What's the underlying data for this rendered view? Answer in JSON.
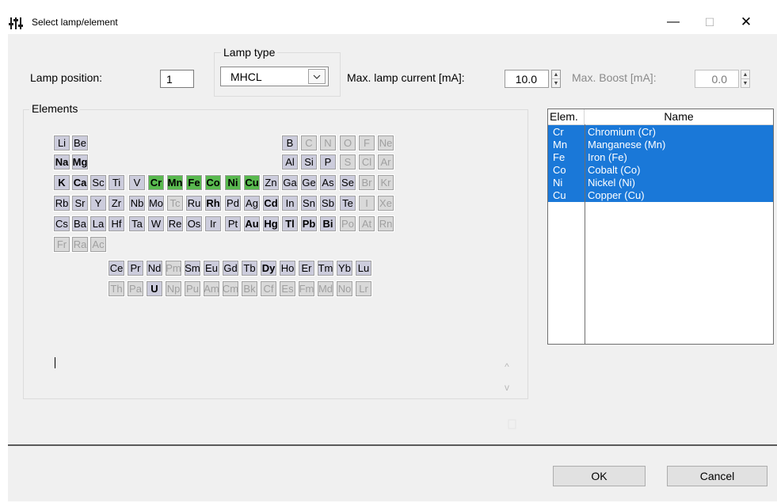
{
  "window": {
    "title": "Select lamp/element",
    "minimize": "—",
    "maximize": "☐",
    "close": "✕"
  },
  "form": {
    "lamp_position_label": "Lamp position:",
    "lamp_position_value": "1",
    "lamp_type_label": "Lamp type",
    "lamp_type_value": "MHCL",
    "max_current_label": "Max. lamp current [mA]:",
    "max_current_value": "10.0",
    "max_boost_label": "Max. Boost [mA]:",
    "max_boost_value": "0.0"
  },
  "elements_group_label": "Elements",
  "elements": [
    {
      "s": "Li",
      "st": "n",
      "r": 0,
      "c": 0
    },
    {
      "s": "Be",
      "st": "n",
      "r": 0,
      "c": 1
    },
    {
      "s": "B",
      "st": "n",
      "r": 0,
      "c": 12
    },
    {
      "s": "C",
      "st": "d",
      "r": 0,
      "c": 13
    },
    {
      "s": "N",
      "st": "d",
      "r": 0,
      "c": 14
    },
    {
      "s": "O",
      "st": "d",
      "r": 0,
      "c": 15
    },
    {
      "s": "F",
      "st": "d",
      "r": 0,
      "c": 16
    },
    {
      "s": "Ne",
      "st": "d",
      "r": 0,
      "c": 17
    },
    {
      "s": "Na",
      "st": "b",
      "r": 1,
      "c": 0
    },
    {
      "s": "Mg",
      "st": "b",
      "r": 1,
      "c": 1
    },
    {
      "s": "Al",
      "st": "n",
      "r": 1,
      "c": 12
    },
    {
      "s": "Si",
      "st": "n",
      "r": 1,
      "c": 13
    },
    {
      "s": "P",
      "st": "n",
      "r": 1,
      "c": 14
    },
    {
      "s": "S",
      "st": "d",
      "r": 1,
      "c": 15
    },
    {
      "s": "Cl",
      "st": "d",
      "r": 1,
      "c": 16
    },
    {
      "s": "Ar",
      "st": "d",
      "r": 1,
      "c": 17
    },
    {
      "s": "K",
      "st": "b",
      "r": 2,
      "c": 0
    },
    {
      "s": "Ca",
      "st": "b",
      "r": 2,
      "c": 1
    },
    {
      "s": "Sc",
      "st": "n",
      "r": 2,
      "c": 2
    },
    {
      "s": "Ti",
      "st": "n",
      "r": 2,
      "c": 3
    },
    {
      "s": "V",
      "st": "n",
      "r": 2,
      "c": 4
    },
    {
      "s": "Cr",
      "st": "s",
      "r": 2,
      "c": 5
    },
    {
      "s": "Mn",
      "st": "s",
      "r": 2,
      "c": 6
    },
    {
      "s": "Fe",
      "st": "s",
      "r": 2,
      "c": 7
    },
    {
      "s": "Co",
      "st": "s",
      "r": 2,
      "c": 8
    },
    {
      "s": "Ni",
      "st": "s",
      "r": 2,
      "c": 9
    },
    {
      "s": "Cu",
      "st": "s",
      "r": 2,
      "c": 10
    },
    {
      "s": "Zn",
      "st": "n",
      "r": 2,
      "c": 11
    },
    {
      "s": "Ga",
      "st": "n",
      "r": 2,
      "c": 12
    },
    {
      "s": "Ge",
      "st": "n",
      "r": 2,
      "c": 13
    },
    {
      "s": "As",
      "st": "n",
      "r": 2,
      "c": 14
    },
    {
      "s": "Se",
      "st": "n",
      "r": 2,
      "c": 15
    },
    {
      "s": "Br",
      "st": "d",
      "r": 2,
      "c": 16
    },
    {
      "s": "Kr",
      "st": "d",
      "r": 2,
      "c": 17
    },
    {
      "s": "Rb",
      "st": "n",
      "r": 3,
      "c": 0
    },
    {
      "s": "Sr",
      "st": "n",
      "r": 3,
      "c": 1
    },
    {
      "s": "Y",
      "st": "n",
      "r": 3,
      "c": 2
    },
    {
      "s": "Zr",
      "st": "n",
      "r": 3,
      "c": 3
    },
    {
      "s": "Nb",
      "st": "n",
      "r": 3,
      "c": 4
    },
    {
      "s": "Mo",
      "st": "n",
      "r": 3,
      "c": 5
    },
    {
      "s": "Tc",
      "st": "d",
      "r": 3,
      "c": 6
    },
    {
      "s": "Ru",
      "st": "n",
      "r": 3,
      "c": 7
    },
    {
      "s": "Rh",
      "st": "b",
      "r": 3,
      "c": 8
    },
    {
      "s": "Pd",
      "st": "n",
      "r": 3,
      "c": 9
    },
    {
      "s": "Ag",
      "st": "n",
      "r": 3,
      "c": 10
    },
    {
      "s": "Cd",
      "st": "b",
      "r": 3,
      "c": 11
    },
    {
      "s": "In",
      "st": "n",
      "r": 3,
      "c": 12
    },
    {
      "s": "Sn",
      "st": "n",
      "r": 3,
      "c": 13
    },
    {
      "s": "Sb",
      "st": "n",
      "r": 3,
      "c": 14
    },
    {
      "s": "Te",
      "st": "n",
      "r": 3,
      "c": 15
    },
    {
      "s": "I",
      "st": "d",
      "r": 3,
      "c": 16
    },
    {
      "s": "Xe",
      "st": "d",
      "r": 3,
      "c": 17
    },
    {
      "s": "Cs",
      "st": "n",
      "r": 4,
      "c": 0
    },
    {
      "s": "Ba",
      "st": "n",
      "r": 4,
      "c": 1
    },
    {
      "s": "La",
      "st": "n",
      "r": 4,
      "c": 2
    },
    {
      "s": "Hf",
      "st": "n",
      "r": 4,
      "c": 3
    },
    {
      "s": "Ta",
      "st": "n",
      "r": 4,
      "c": 4
    },
    {
      "s": "W",
      "st": "n",
      "r": 4,
      "c": 5
    },
    {
      "s": "Re",
      "st": "n",
      "r": 4,
      "c": 6
    },
    {
      "s": "Os",
      "st": "n",
      "r": 4,
      "c": 7
    },
    {
      "s": "Ir",
      "st": "n",
      "r": 4,
      "c": 8
    },
    {
      "s": "Pt",
      "st": "n",
      "r": 4,
      "c": 9
    },
    {
      "s": "Au",
      "st": "b",
      "r": 4,
      "c": 10
    },
    {
      "s": "Hg",
      "st": "b",
      "r": 4,
      "c": 11
    },
    {
      "s": "Tl",
      "st": "b",
      "r": 4,
      "c": 12
    },
    {
      "s": "Pb",
      "st": "b",
      "r": 4,
      "c": 13
    },
    {
      "s": "Bi",
      "st": "b",
      "r": 4,
      "c": 14
    },
    {
      "s": "Po",
      "st": "d",
      "r": 4,
      "c": 15
    },
    {
      "s": "At",
      "st": "d",
      "r": 4,
      "c": 16
    },
    {
      "s": "Rn",
      "st": "d",
      "r": 4,
      "c": 17
    },
    {
      "s": "Fr",
      "st": "d",
      "r": 5,
      "c": 0
    },
    {
      "s": "Ra",
      "st": "d",
      "r": 5,
      "c": 1
    },
    {
      "s": "Ac",
      "st": "d",
      "r": 5,
      "c": 2
    },
    {
      "s": "Ce",
      "st": "n",
      "r": 6,
      "c": 3
    },
    {
      "s": "Pr",
      "st": "n",
      "r": 6,
      "c": 4
    },
    {
      "s": "Nd",
      "st": "n",
      "r": 6,
      "c": 5
    },
    {
      "s": "Pm",
      "st": "d",
      "r": 6,
      "c": 6
    },
    {
      "s": "Sm",
      "st": "n",
      "r": 6,
      "c": 7
    },
    {
      "s": "Eu",
      "st": "n",
      "r": 6,
      "c": 8
    },
    {
      "s": "Gd",
      "st": "n",
      "r": 6,
      "c": 9
    },
    {
      "s": "Tb",
      "st": "n",
      "r": 6,
      "c": 10
    },
    {
      "s": "Dy",
      "st": "b",
      "r": 6,
      "c": 11
    },
    {
      "s": "Ho",
      "st": "n",
      "r": 6,
      "c": 12
    },
    {
      "s": "Er",
      "st": "n",
      "r": 6,
      "c": 13
    },
    {
      "s": "Tm",
      "st": "n",
      "r": 6,
      "c": 14
    },
    {
      "s": "Yb",
      "st": "n",
      "r": 6,
      "c": 15
    },
    {
      "s": "Lu",
      "st": "n",
      "r": 6,
      "c": 16
    },
    {
      "s": "Th",
      "st": "d",
      "r": 7,
      "c": 3
    },
    {
      "s": "Pa",
      "st": "d",
      "r": 7,
      "c": 4
    },
    {
      "s": "U",
      "st": "b",
      "r": 7,
      "c": 5
    },
    {
      "s": "Np",
      "st": "d",
      "r": 7,
      "c": 6
    },
    {
      "s": "Pu",
      "st": "d",
      "r": 7,
      "c": 7
    },
    {
      "s": "Am",
      "st": "d",
      "r": 7,
      "c": 8
    },
    {
      "s": "Cm",
      "st": "d",
      "r": 7,
      "c": 9
    },
    {
      "s": "Bk",
      "st": "d",
      "r": 7,
      "c": 10
    },
    {
      "s": "Cf",
      "st": "d",
      "r": 7,
      "c": 11
    },
    {
      "s": "Es",
      "st": "d",
      "r": 7,
      "c": 12
    },
    {
      "s": "Fm",
      "st": "d",
      "r": 7,
      "c": 13
    },
    {
      "s": "Md",
      "st": "d",
      "r": 7,
      "c": 14
    },
    {
      "s": "No",
      "st": "d",
      "r": 7,
      "c": 15
    },
    {
      "s": "Lr",
      "st": "d",
      "r": 7,
      "c": 16
    }
  ],
  "element_list": {
    "headers": [
      "Elem.",
      "Name"
    ],
    "rows": [
      {
        "symbol": "Cr",
        "name": "Chromium (Cr)"
      },
      {
        "symbol": "Mn",
        "name": "Manganese (Mn)"
      },
      {
        "symbol": "Fe",
        "name": "Iron (Fe)"
      },
      {
        "symbol": "Co",
        "name": "Cobalt (Co)"
      },
      {
        "symbol": "Ni",
        "name": "Nickel (Ni)"
      },
      {
        "symbol": "Cu",
        "name": "Copper (Cu)"
      }
    ]
  },
  "buttons": {
    "ok": "OK",
    "cancel": "Cancel"
  },
  "colors": {
    "element_normal": "#ccccdc",
    "element_selected": "#59b94f",
    "element_disabled": "#d9d9d9",
    "list_selection": "#1a78d8"
  }
}
